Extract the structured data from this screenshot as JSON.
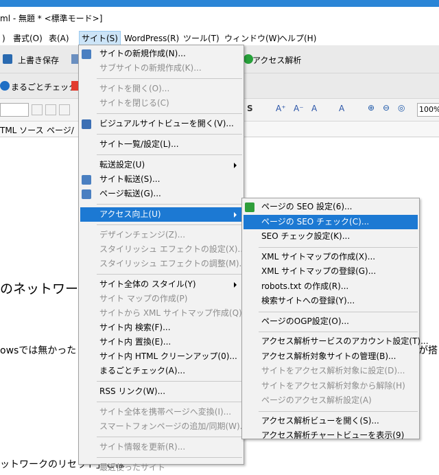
{
  "window": {
    "title": "ml - 無題 * <標準モード>]"
  },
  "menubar": [
    {
      "label": ")"
    },
    {
      "label": "書式(O)"
    },
    {
      "label": "表(A)"
    },
    {
      "label": "サイト(S)"
    },
    {
      "label": "WordPress(R)"
    },
    {
      "label": "ツール(T)"
    },
    {
      "label": "ウィンドウ(W)"
    },
    {
      "label": "ヘルプ(H)"
    }
  ],
  "toolbar": {
    "overwrite_save": "上書き保存",
    "access_analysis": "アクセス解析",
    "marugoto_check": "まるごとチェック",
    "zoom_text": "100%"
  },
  "tabs": {
    "html_source": "TML ソース",
    "page": "ページ/"
  },
  "document": {
    "line1": "のネットワーク",
    "line2": "owsでは無かった",
    "line2_right": "が搭",
    "line3": "ットワークのリセット」とは"
  },
  "site_menu": [
    {
      "label": "サイトの新規作成(N)...",
      "enabled": true,
      "icon": "new-site-icon"
    },
    {
      "label": "サブサイトの新規作成(K)...",
      "enabled": false
    },
    {
      "sep": true
    },
    {
      "label": "サイトを開く(O)...",
      "enabled": false
    },
    {
      "label": "サイトを閉じる(C)",
      "enabled": false
    },
    {
      "sep": true
    },
    {
      "label": "ビジュアルサイトビューを開く(V)...",
      "enabled": true,
      "icon": "site-view-icon"
    },
    {
      "sep": true
    },
    {
      "label": "サイト一覧/設定(L)...",
      "enabled": true
    },
    {
      "sep": true
    },
    {
      "label": "転送設定(U)",
      "enabled": true,
      "submenu": true
    },
    {
      "label": "サイト転送(S)...",
      "enabled": true,
      "icon": "site-transfer-icon"
    },
    {
      "label": "ページ転送(G)...",
      "enabled": true,
      "icon": "page-transfer-icon"
    },
    {
      "sep": true
    },
    {
      "label": "アクセス向上(U)",
      "enabled": true,
      "submenu": true,
      "highlighted": true
    },
    {
      "sep": true
    },
    {
      "label": "デザインチェンジ(Z)...",
      "enabled": false
    },
    {
      "label": "スタイリッシュ エフェクトの設定(X)...",
      "enabled": false
    },
    {
      "label": "スタイリッシュ エフェクトの調整(M)...",
      "enabled": false
    },
    {
      "sep": true
    },
    {
      "label": "サイト全体の スタイル(Y)",
      "enabled": true,
      "submenu": true
    },
    {
      "label": "サイト マップの作成(P)",
      "enabled": false
    },
    {
      "label": "サイトから XML サイトマップ作成(Q)",
      "enabled": false
    },
    {
      "label": "サイト内 検索(F)...",
      "enabled": true
    },
    {
      "label": "サイト内 置換(E)...",
      "enabled": true
    },
    {
      "label": "サイト内 HTML クリーンアップ(0)...",
      "enabled": true
    },
    {
      "label": "まるごとチェック(A)...",
      "enabled": true
    },
    {
      "sep": true
    },
    {
      "label": "RSS リンク(W)...",
      "enabled": true
    },
    {
      "sep": true
    },
    {
      "label": "サイト全体を携帯ページへ変換(I)...",
      "enabled": false
    },
    {
      "label": "スマートフォンページの追加/同期(W)...",
      "enabled": false
    },
    {
      "sep": true
    },
    {
      "label": "サイト情報を更新(R)...",
      "enabled": false
    },
    {
      "sep": true
    },
    {
      "label": "最近使ったサイト",
      "enabled": false
    }
  ],
  "access_submenu": [
    {
      "label": "ページの SEO 設定(6)...",
      "enabled": true,
      "icon": "seo-icon"
    },
    {
      "label": "ページの SEO チェック(C)...",
      "enabled": true,
      "highlighted": true
    },
    {
      "label": "SEO チェック設定(K)...",
      "enabled": true
    },
    {
      "sep": true
    },
    {
      "label": "XML サイトマップの作成(X)...",
      "enabled": true
    },
    {
      "label": "XML サイトマップの登録(G)...",
      "enabled": true
    },
    {
      "label": "robots.txt の作成(R)...",
      "enabled": true
    },
    {
      "label": "検索サイトへの登録(Y)...",
      "enabled": true
    },
    {
      "sep": true
    },
    {
      "label": "ページのOGP設定(O)...",
      "enabled": true
    },
    {
      "sep": true
    },
    {
      "label": "アクセス解析サービスのアカウント設定(T)...",
      "enabled": true
    },
    {
      "label": "アクセス解析対象サイトの管理(B)...",
      "enabled": true
    },
    {
      "label": "サイトをアクセス解析対象に設定(D)...",
      "enabled": false
    },
    {
      "label": "サイトをアクセス解析対象から解除(H)",
      "enabled": false
    },
    {
      "label": "ページのアクセス解析設定(A)",
      "enabled": false
    },
    {
      "sep": true
    },
    {
      "label": "アクセス解析ビューを開く(S)...",
      "enabled": true
    },
    {
      "label": "アクセス解析チャートビューを表示(9)",
      "enabled": true
    }
  ]
}
